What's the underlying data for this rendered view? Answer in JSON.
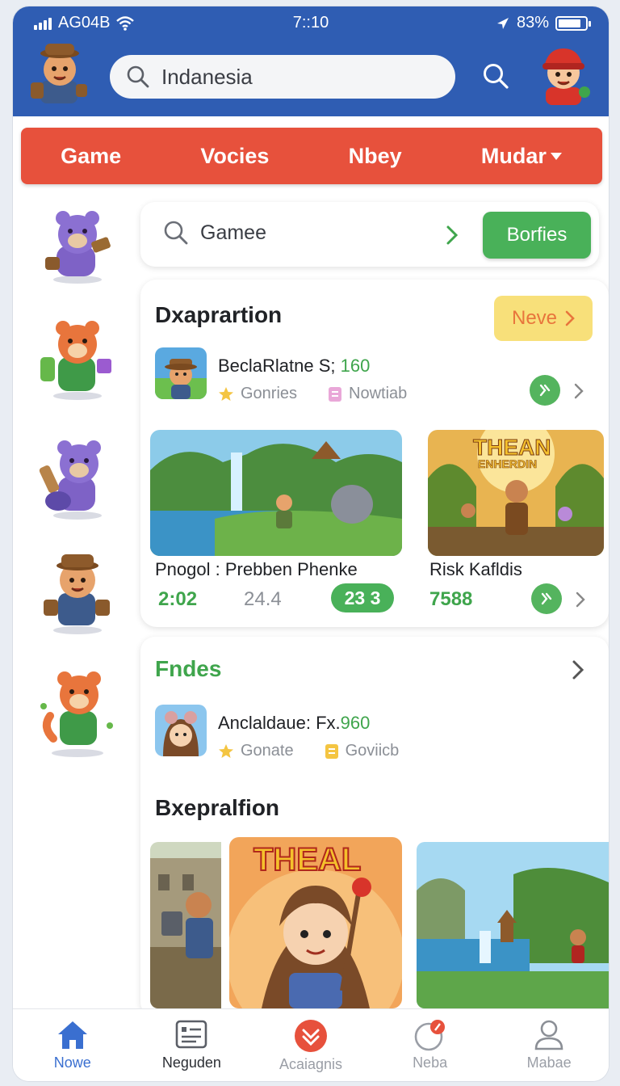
{
  "status_bar": {
    "carrier": "AG04B",
    "time": "7::10",
    "battery": "83%",
    "battery_level": 0.83
  },
  "header": {
    "search_value": "Indanesia"
  },
  "categories": [
    "Game",
    "Vocies",
    "Nbey",
    "Mudar"
  ],
  "filter_search": {
    "value": "Gamee",
    "button_label": "Borfies"
  },
  "section1": {
    "title": "Dxaprartion",
    "more_label": "Neve",
    "featured": {
      "name": "BeclaRlatne S;",
      "value": "160",
      "meta1": "Gonries",
      "meta2": "Nowtiab"
    },
    "games": [
      {
        "title": "Pnogol : Prebben Phenke",
        "stat1": "2:02",
        "stat2": "24.4",
        "badge": "23 3"
      },
      {
        "title": "Risk Kafldis",
        "stat1": "7588",
        "banner_text_1": "THEAN",
        "banner_text_2": "ENHERDIN"
      }
    ]
  },
  "section2": {
    "title": "Fndes",
    "featured": {
      "name": "Anclaldaue: Fx.",
      "value": "960",
      "meta1": "Gonate",
      "meta2": "Goviicb"
    },
    "subtitle": "Bxepralfion",
    "banner_text": "THEAL"
  },
  "nav": [
    {
      "label": "Nowe",
      "icon": "home-icon",
      "active": true
    },
    {
      "label": "Neguden",
      "icon": "list-card-icon",
      "active": false
    },
    {
      "label": "Acaiagnis",
      "icon": "chevron-badge-icon",
      "active": false
    },
    {
      "label": "Neba",
      "icon": "notification-icon",
      "active": false
    },
    {
      "label": "Mabae",
      "icon": "profile-icon",
      "active": false
    }
  ],
  "colors": {
    "header_blue": "#2f5db3",
    "category_red": "#e7513c",
    "accent_green": "#3fa54c",
    "more_yellow": "#f8e07a"
  }
}
